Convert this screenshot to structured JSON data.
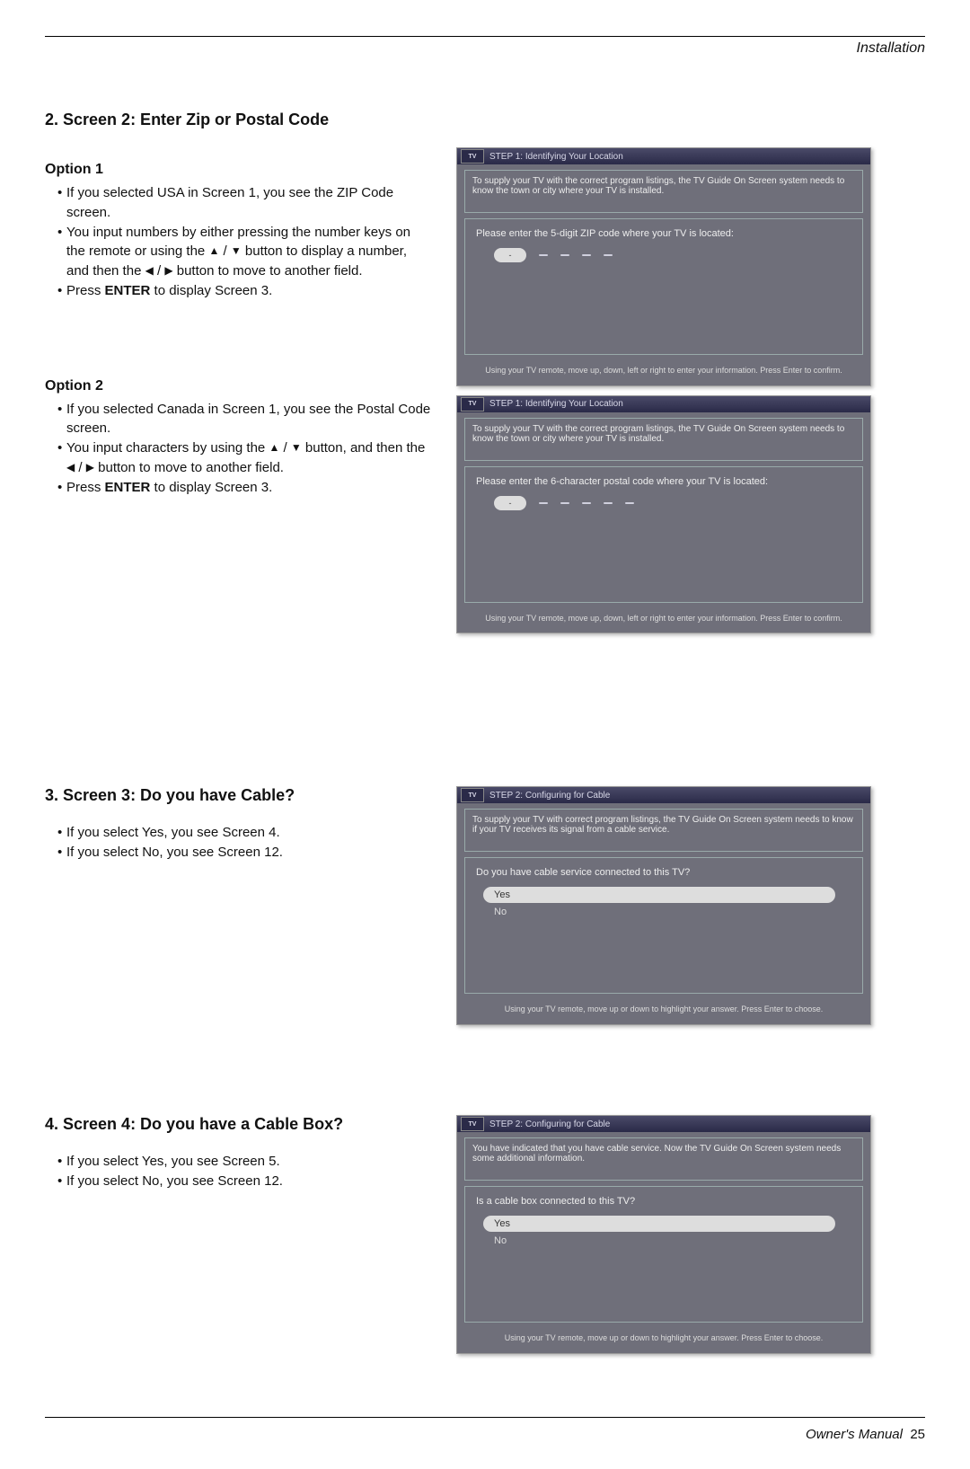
{
  "header": {
    "section": "Installation"
  },
  "s2": {
    "heading": "2. Screen 2: Enter Zip or Postal Code",
    "option1": {
      "heading": "Option 1",
      "l1": "If you selected USA in Screen 1, you see the ZIP Code screen.",
      "l2a": "You input numbers by either pressing the number keys on the remote or using the ",
      "l2b": " button to display a number, and then the ",
      "l2c": " button to move to another field.",
      "l3a": "Press ",
      "l3b": "ENTER",
      "l3c": " to display Screen 3."
    },
    "option2": {
      "heading": "Option 2",
      "l1": "If you selected Canada in Screen 1, you see the Postal Code screen.",
      "l2a": "You input characters by using the ",
      "l2b": " button, and then the ",
      "l2c": " button to move to another field.",
      "l3a": "Press ",
      "l3b": "ENTER",
      "l3c": " to display Screen 3."
    },
    "tv1": {
      "title": "STEP 1: Identifying Your Location",
      "desc": "To supply your TV with the correct program listings, the TV Guide On Screen system needs to know the town or city where your TV is installed.",
      "prompt": "Please enter the 5-digit ZIP code where your TV is located:",
      "footer": "Using your TV remote, move up, down, left or right to enter your information. Press Enter to confirm."
    },
    "tv2": {
      "title": "STEP 1: Identifying Your Location",
      "desc": "To supply your TV with the correct program listings, the TV Guide On Screen system needs to know the town or city where your TV is installed.",
      "prompt": "Please enter the 6-character postal code where your TV is located:",
      "footer": "Using your TV remote, move up, down, left or right to enter your information. Press Enter to confirm."
    }
  },
  "s3": {
    "heading": "3. Screen 3: Do you have Cable?",
    "l1": "If you select Yes, you see Screen 4.",
    "l2": "If you select No, you see Screen 12.",
    "tv": {
      "title": "STEP 2: Configuring for Cable",
      "desc": "To supply your TV with correct program listings, the TV Guide On Screen system needs to know if your TV receives its signal from a cable service.",
      "prompt": "Do you have cable service connected to this TV?",
      "yes": "Yes",
      "no": "No",
      "footer": "Using your TV remote, move up or down to highlight your answer.  Press Enter to choose."
    }
  },
  "s4": {
    "heading": "4. Screen 4: Do you have a Cable Box?",
    "l1": "If you select Yes, you see Screen 5.",
    "l2": "If you select No, you see Screen 12.",
    "tv": {
      "title": "STEP 2: Configuring for Cable",
      "desc": "You have indicated that you have cable service. Now the TV Guide On Screen system needs some additional information.",
      "prompt": "Is a cable box connected to this TV?",
      "yes": "Yes",
      "no": "No",
      "footer": "Using your TV remote, move up or down to highlight your answer.  Press Enter to choose."
    }
  },
  "footer": {
    "owners": "Owner's Manual",
    "page": "25"
  },
  "glyphs": {
    "up": "▲",
    "down": "▼",
    "left": "◀",
    "right": "▶",
    "slash": " / ",
    "dash": "-"
  },
  "logo": "TV"
}
